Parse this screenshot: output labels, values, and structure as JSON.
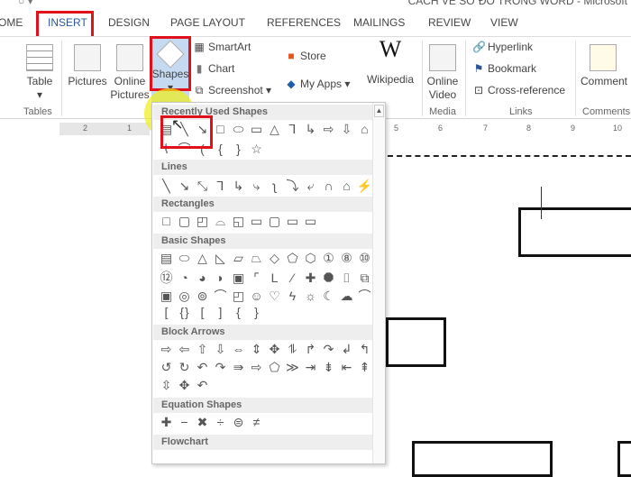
{
  "window": {
    "title": "CÁCH VẼ SƠ ĐỒ TRONG WORD - Microsoft"
  },
  "tabs": [
    "OME",
    "INSERT",
    "DESIGN",
    "PAGE LAYOUT",
    "REFERENCES",
    "MAILINGS",
    "REVIEW",
    "VIEW"
  ],
  "active_tab": "INSERT",
  "ribbon": {
    "table": "Table",
    "pictures": "Pictures",
    "online_pictures_1": "Online",
    "online_pictures_2": "Pictures",
    "shapes": "Shapes",
    "smartart": "SmartArt",
    "chart": "Chart",
    "screenshot": "Screenshot ▾",
    "store": "Store",
    "my_apps": "My Apps",
    "wikipedia": "Wikipedia",
    "wiki_logo": "W",
    "online_video_1": "Online",
    "online_video_2": "Video",
    "hyperlink": "Hyperlink",
    "bookmark": "Bookmark",
    "cross_reference": "Cross-reference",
    "comment": "Comment",
    "groups": {
      "tables": "Tables",
      "media": "Media",
      "links": "Links",
      "comments": "Comments"
    }
  },
  "ruler": [
    "2",
    "1",
    "5",
    "6",
    "7",
    "8",
    "9",
    "10"
  ],
  "accent_color": "#e0111b",
  "shapes_menu": {
    "sections": [
      {
        "title": "Recently Used Shapes",
        "rows": [
          [
            "▤",
            "╲",
            "↘",
            "□",
            "⬭",
            "▭",
            "△",
            "⅂",
            "↳",
            "⇨",
            "⇩",
            "⌂"
          ],
          [
            "⌇",
            "⌒",
            "(",
            "{",
            "}",
            "☆"
          ]
        ]
      },
      {
        "title": "Lines",
        "rows": [
          [
            "╲",
            "↘",
            "⤡",
            "⅂",
            "↳",
            "⤷",
            "ʅ",
            "⤵",
            "⤶",
            "∩",
            "⌂",
            "⚡"
          ]
        ]
      },
      {
        "title": "Rectangles",
        "rows": [
          [
            "□",
            "▢",
            "◰",
            "⌓",
            "◱",
            "▭",
            "▢",
            "▭",
            "▭"
          ]
        ]
      },
      {
        "title": "Basic Shapes",
        "rows": [
          [
            "▤",
            "⬭",
            "△",
            "◺",
            "▱",
            "⏢",
            "◇",
            "⬠",
            "⬡",
            "①",
            "⑧",
            "⑩"
          ],
          [
            "⑫",
            "◔",
            "◕",
            "◗",
            "▣",
            "⌜",
            "L",
            "⁄",
            "✚",
            "⯃",
            "⌷",
            "⧉"
          ],
          [
            "▣",
            "◎",
            "⊚",
            "⌒",
            "◰",
            "☺",
            "♡",
            "ϟ",
            "☼",
            "☾",
            "☁",
            "⌒"
          ],
          [
            "[",
            "{}",
            "[",
            "]",
            "{",
            "}"
          ]
        ]
      },
      {
        "title": "Block Arrows",
        "rows": [
          [
            "⇨",
            "⇦",
            "⇧",
            "⇩",
            "⇔",
            "⇕",
            "✥",
            "⥮",
            "↱",
            "↷",
            "↲",
            "↰"
          ],
          [
            "↺",
            "↻",
            "↶",
            "↷",
            "⇛",
            "⇨",
            "⬠",
            "≫",
            "⇥",
            "⇟",
            "⇤",
            "⇞"
          ],
          [
            "⇳",
            "✥",
            "↶"
          ]
        ]
      },
      {
        "title": "Equation Shapes",
        "rows": [
          [
            "✚",
            "−",
            "✖",
            "÷",
            "⊜",
            "≠"
          ]
        ]
      },
      {
        "title": "Flowchart",
        "rows": []
      }
    ]
  }
}
